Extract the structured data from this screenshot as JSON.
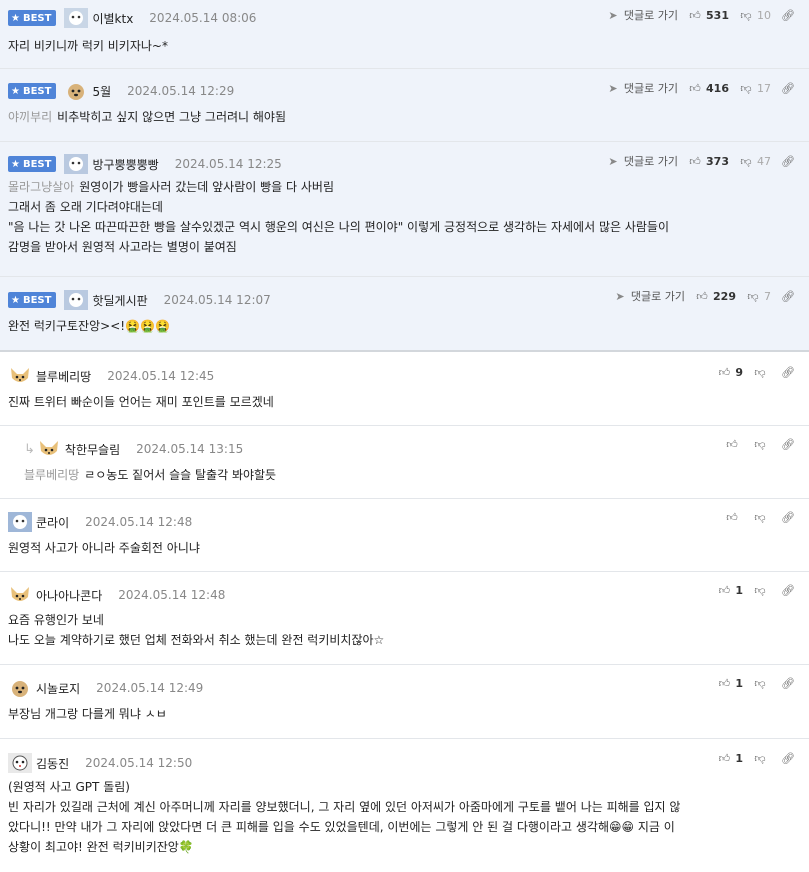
{
  "labels": {
    "best": "BEST",
    "goto": "댓글로 가기"
  },
  "comments": [
    {
      "best": true,
      "user": "이별ktx",
      "date": "2024.05.14 08:06",
      "quote": "",
      "lines": [
        "자리 비키니까 럭키 비키자나~*"
      ],
      "up": "531",
      "down": "10"
    },
    {
      "best": true,
      "user": "5월",
      "date": "2024.05.14 12:29",
      "quote": "야끼부리",
      "lines": [
        "비추박히고 싶지 않으면 그냥 그러려니 해야됨"
      ],
      "up": "416",
      "down": "17"
    },
    {
      "best": true,
      "user": "방구뿡뿡뿡빵",
      "date": "2024.05.14 12:25",
      "quote": "몰라그냥살아",
      "lines": [
        "원영이가 빵을사러 갔는데 앞사람이 빵을 다 사버림",
        "그래서 좀 오래 기다려야대는데",
        "\"음 나는 갓 나온 따끈따끈한 빵을 살수있겠군 역시 행운의 여신은 나의 편이야\" 이렇게 긍정적으로 생각하는 자세에서 많은 사람들이",
        "감명을 받아서 원영적 사고라는 별명이 붙여짐"
      ],
      "up": "373",
      "down": "47"
    },
    {
      "best": true,
      "user": "핫딜게시판",
      "date": "2024.05.14 12:07",
      "quote": "",
      "lines": [
        "완전 럭키구토잔앙><!🤮🤮🤮"
      ],
      "up": "229",
      "down": "7"
    },
    {
      "best": false,
      "reply": false,
      "user": "블루베리땅",
      "date": "2024.05.14 12:45",
      "quote": "",
      "lines": [
        "진짜 트위터 빠순이들 언어는 재미 포인트를 모르겠네"
      ],
      "up": "9",
      "down": ""
    },
    {
      "best": false,
      "reply": true,
      "user": "착한무슬림",
      "date": "2024.05.14 13:15",
      "quote": "블루베리땅",
      "lines": [
        "ㄹㅇ농도 짙어서 슬슬 탈출각 봐야할듯"
      ],
      "up": "",
      "down": ""
    },
    {
      "best": false,
      "reply": false,
      "user": "쿤라이",
      "date": "2024.05.14 12:48",
      "quote": "",
      "lines": [
        "원영적 사고가 아니라 주술회전 아니냐"
      ],
      "up": "",
      "down": ""
    },
    {
      "best": false,
      "reply": false,
      "user": "아나아나콘다",
      "date": "2024.05.14 12:48",
      "quote": "",
      "lines": [
        "요즘 유행인가 보네",
        "나도 오늘 계약하기로 했던 업체 전화와서 취소 했는데 완전 럭키비치잖아☆"
      ],
      "up": "1",
      "down": ""
    },
    {
      "best": false,
      "reply": false,
      "user": "시놀로지",
      "date": "2024.05.14 12:49",
      "quote": "",
      "lines": [
        "부장님 개그랑 다를게 뭐냐 ㅅㅂ"
      ],
      "up": "1",
      "down": ""
    },
    {
      "best": false,
      "reply": false,
      "user": "김동진",
      "date": "2024.05.14 12:50",
      "quote": "",
      "lines": [
        "(원영적 사고 GPT 돌림)",
        "빈 자리가 있길래 근처에 계신 아주머니께 자리를 양보했더니, 그 자리 옆에 있던 아저씨가 아줌마에게 구토를 뱉어 나는 피해를 입지 않",
        "았다니!! 만약 내가 그 자리에 앉았다면 더 큰 피해를 입을 수도 있었을텐데, 이번에는 그렇게 안 된 걸 다행이라고 생각해😁😁 지금 이",
        "상황이 최고야! 완전 럭키비키잔앙🍀"
      ],
      "up": "1",
      "down": ""
    }
  ],
  "icons": {
    "thumb_up": "thumb-up-icon",
    "thumb_down": "thumb-down-icon",
    "link": "link-icon",
    "goto": "arrow-icon",
    "star": "star-icon"
  }
}
